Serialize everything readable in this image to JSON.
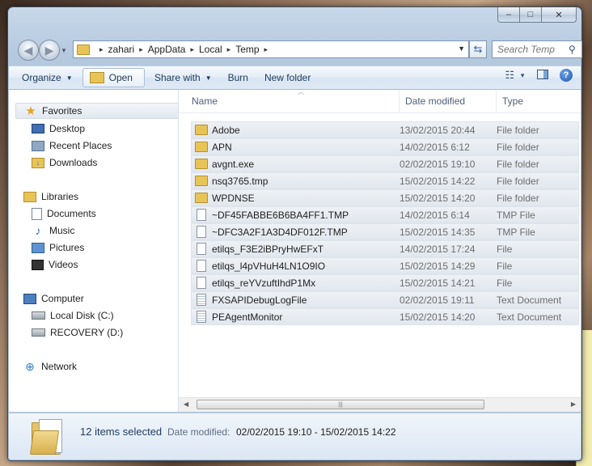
{
  "window": {
    "caption_buttons": {
      "minimize": "–",
      "maximize": "□",
      "close": "✕"
    }
  },
  "address_bar": {
    "crumbs": [
      "zahari",
      "AppData",
      "Local",
      "Temp"
    ],
    "separator": "▸"
  },
  "search": {
    "placeholder": "Search Temp"
  },
  "toolbar": {
    "organize": "Organize",
    "open": "Open",
    "share_with": "Share with",
    "burn": "Burn",
    "new_folder": "New folder"
  },
  "navigation": {
    "favorites": {
      "label": "Favorites",
      "items": [
        "Desktop",
        "Recent Places",
        "Downloads"
      ]
    },
    "libraries": {
      "label": "Libraries",
      "items": [
        "Documents",
        "Music",
        "Pictures",
        "Videos"
      ]
    },
    "computer": {
      "label": "Computer",
      "items": [
        "Local Disk (C:)",
        "RECOVERY (D:)"
      ]
    },
    "network": {
      "label": "Network"
    }
  },
  "columns": {
    "name": "Name",
    "date_modified": "Date modified",
    "type": "Type"
  },
  "files": [
    {
      "name": "Adobe",
      "date": "13/02/2015 20:44",
      "type": "File folder",
      "icon": "folder-icon"
    },
    {
      "name": "APN",
      "date": "14/02/2015 6:12",
      "type": "File folder",
      "icon": "folder-icon"
    },
    {
      "name": "avgnt.exe",
      "date": "02/02/2015 19:10",
      "type": "File folder",
      "icon": "folder-icon"
    },
    {
      "name": "nsq3765.tmp",
      "date": "15/02/2015 14:22",
      "type": "File folder",
      "icon": "folder-icon"
    },
    {
      "name": "WPDNSE",
      "date": "15/02/2015 14:20",
      "type": "File folder",
      "icon": "folder-icon"
    },
    {
      "name": "~DF45FABBE6B6BA4FF1.TMP",
      "date": "14/02/2015 6:14",
      "type": "TMP File",
      "icon": "file-icon"
    },
    {
      "name": "~DFC3A2F1A3D4DF012F.TMP",
      "date": "15/02/2015 14:35",
      "type": "TMP File",
      "icon": "file-icon"
    },
    {
      "name": "etilqs_F3E2iBPryHwEFxT",
      "date": "14/02/2015 17:24",
      "type": "File",
      "icon": "file-icon"
    },
    {
      "name": "etilqs_l4pVHuH4LN1O9IO",
      "date": "15/02/2015 14:29",
      "type": "File",
      "icon": "file-icon"
    },
    {
      "name": "etilqs_reYVzuftIhdP1Mx",
      "date": "15/02/2015 14:21",
      "type": "File",
      "icon": "file-icon"
    },
    {
      "name": "FXSAPIDebugLogFile",
      "date": "02/02/2015 19:11",
      "type": "Text Document",
      "icon": "text-document-icon"
    },
    {
      "name": "PEAgentMonitor",
      "date": "15/02/2015 14:20",
      "type": "Text Document",
      "icon": "text-document-icon"
    }
  ],
  "details": {
    "selected": "12 items selected",
    "date_label": "Date modified:",
    "date_value": "02/02/2015 19:10 - 15/02/2015 14:22"
  },
  "colors": {
    "folder": "#e8c457",
    "selection_row": "#e2e7ee",
    "toolbar_text": "#1e395b"
  }
}
